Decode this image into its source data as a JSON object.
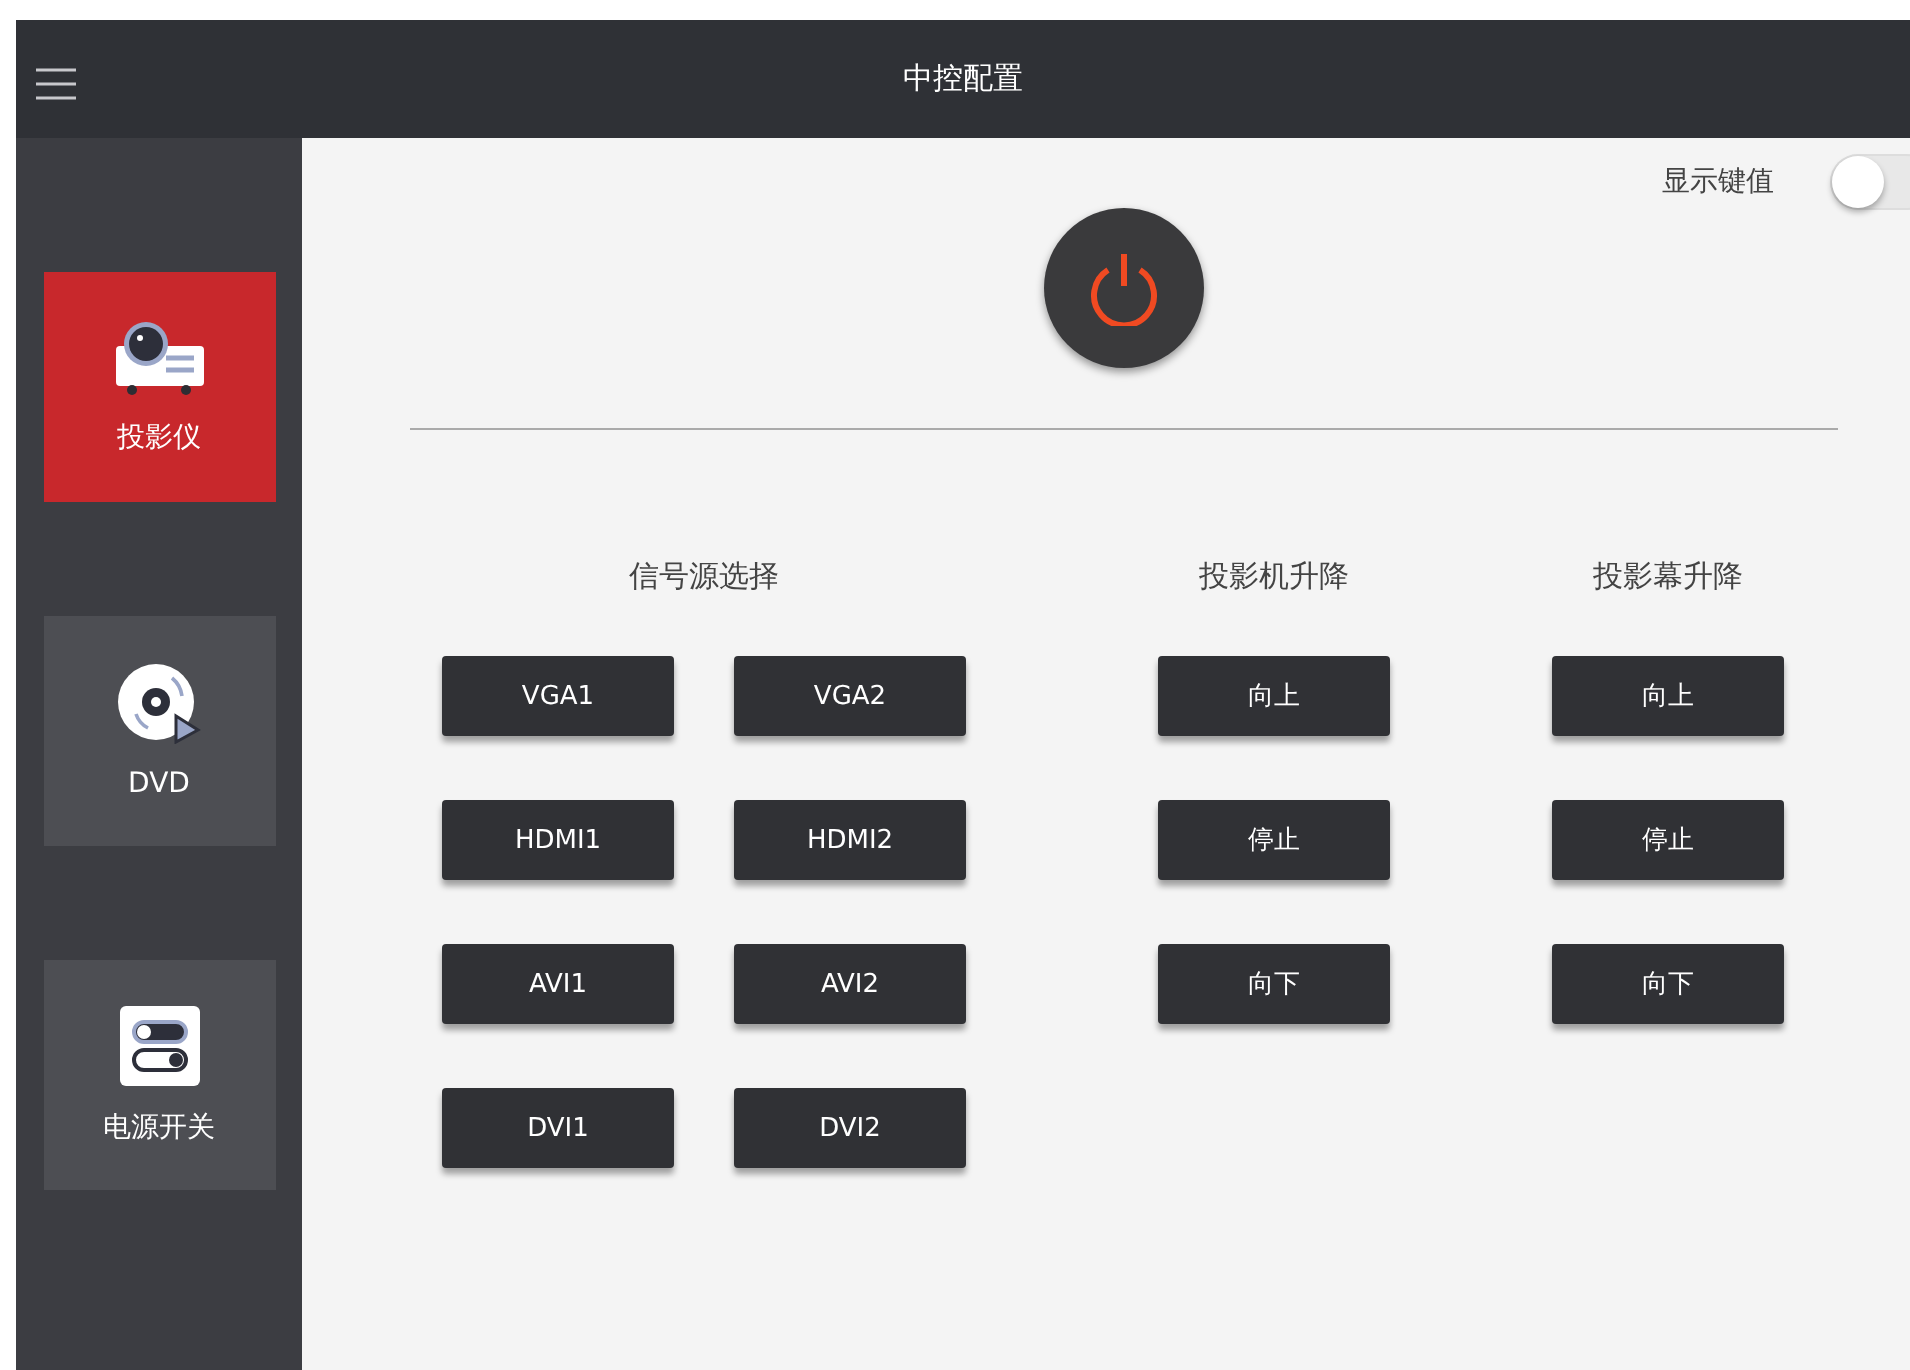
{
  "header": {
    "title": "中控配置"
  },
  "sidebar": {
    "items": [
      {
        "label": "投影仪",
        "kind": "projector",
        "selected": true
      },
      {
        "label": "DVD",
        "kind": "disc",
        "selected": false
      },
      {
        "label": "电源开关",
        "kind": "switches",
        "selected": false
      }
    ]
  },
  "key_toggle": {
    "label": "显示键值",
    "on": false
  },
  "groups": [
    {
      "title": "信号源选择",
      "buttons": [
        "VGA1",
        "VGA2",
        "HDMI1",
        "HDMI2",
        "AVI1",
        "AVI2",
        "DVI1",
        "DVI2"
      ]
    },
    {
      "title": "投影机升降",
      "buttons": [
        "向上",
        "停止",
        "向下"
      ]
    },
    {
      "title": "投影幕升降",
      "buttons": [
        "向上",
        "停止",
        "向下"
      ]
    }
  ]
}
